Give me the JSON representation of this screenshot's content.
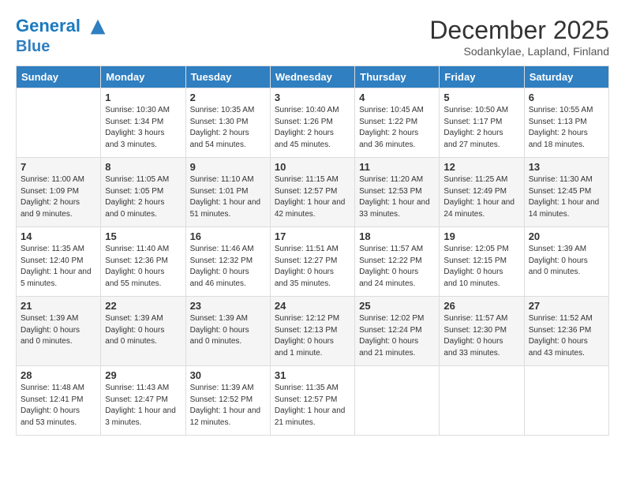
{
  "header": {
    "logo_line1": "General",
    "logo_line2": "Blue",
    "month": "December 2025",
    "location": "Sodankylae, Lapland, Finland"
  },
  "weekdays": [
    "Sunday",
    "Monday",
    "Tuesday",
    "Wednesday",
    "Thursday",
    "Friday",
    "Saturday"
  ],
  "weeks": [
    [
      {
        "day": "",
        "info": ""
      },
      {
        "day": "1",
        "info": "Sunrise: 10:30 AM\nSunset: 1:34 PM\nDaylight: 3 hours\nand 3 minutes."
      },
      {
        "day": "2",
        "info": "Sunrise: 10:35 AM\nSunset: 1:30 PM\nDaylight: 2 hours\nand 54 minutes."
      },
      {
        "day": "3",
        "info": "Sunrise: 10:40 AM\nSunset: 1:26 PM\nDaylight: 2 hours\nand 45 minutes."
      },
      {
        "day": "4",
        "info": "Sunrise: 10:45 AM\nSunset: 1:22 PM\nDaylight: 2 hours\nand 36 minutes."
      },
      {
        "day": "5",
        "info": "Sunrise: 10:50 AM\nSunset: 1:17 PM\nDaylight: 2 hours\nand 27 minutes."
      },
      {
        "day": "6",
        "info": "Sunrise: 10:55 AM\nSunset: 1:13 PM\nDaylight: 2 hours\nand 18 minutes."
      }
    ],
    [
      {
        "day": "7",
        "info": "Sunrise: 11:00 AM\nSunset: 1:09 PM\nDaylight: 2 hours\nand 9 minutes."
      },
      {
        "day": "8",
        "info": "Sunrise: 11:05 AM\nSunset: 1:05 PM\nDaylight: 2 hours\nand 0 minutes."
      },
      {
        "day": "9",
        "info": "Sunrise: 11:10 AM\nSunset: 1:01 PM\nDaylight: 1 hour and\n51 minutes."
      },
      {
        "day": "10",
        "info": "Sunrise: 11:15 AM\nSunset: 12:57 PM\nDaylight: 1 hour and\n42 minutes."
      },
      {
        "day": "11",
        "info": "Sunrise: 11:20 AM\nSunset: 12:53 PM\nDaylight: 1 hour and\n33 minutes."
      },
      {
        "day": "12",
        "info": "Sunrise: 11:25 AM\nSunset: 12:49 PM\nDaylight: 1 hour and\n24 minutes."
      },
      {
        "day": "13",
        "info": "Sunrise: 11:30 AM\nSunset: 12:45 PM\nDaylight: 1 hour and\n14 minutes."
      }
    ],
    [
      {
        "day": "14",
        "info": "Sunrise: 11:35 AM\nSunset: 12:40 PM\nDaylight: 1 hour and\n5 minutes."
      },
      {
        "day": "15",
        "info": "Sunrise: 11:40 AM\nSunset: 12:36 PM\nDaylight: 0 hours\nand 55 minutes."
      },
      {
        "day": "16",
        "info": "Sunrise: 11:46 AM\nSunset: 12:32 PM\nDaylight: 0 hours\nand 46 minutes."
      },
      {
        "day": "17",
        "info": "Sunrise: 11:51 AM\nSunset: 12:27 PM\nDaylight: 0 hours\nand 35 minutes."
      },
      {
        "day": "18",
        "info": "Sunrise: 11:57 AM\nSunset: 12:22 PM\nDaylight: 0 hours\nand 24 minutes."
      },
      {
        "day": "19",
        "info": "Sunrise: 12:05 PM\nSunset: 12:15 PM\nDaylight: 0 hours\nand 10 minutes."
      },
      {
        "day": "20",
        "info": "Sunset: 1:39 AM\nDaylight: 0 hours\nand 0 minutes."
      }
    ],
    [
      {
        "day": "21",
        "info": "Sunset: 1:39 AM\nDaylight: 0 hours\nand 0 minutes."
      },
      {
        "day": "22",
        "info": "Sunset: 1:39 AM\nDaylight: 0 hours\nand 0 minutes."
      },
      {
        "day": "23",
        "info": "Sunset: 1:39 AM\nDaylight: 0 hours\nand 0 minutes."
      },
      {
        "day": "24",
        "info": "Sunrise: 12:12 PM\nSunset: 12:13 PM\nDaylight: 0 hours\nand 1 minute."
      },
      {
        "day": "25",
        "info": "Sunrise: 12:02 PM\nSunset: 12:24 PM\nDaylight: 0 hours\nand 21 minutes."
      },
      {
        "day": "26",
        "info": "Sunrise: 11:57 AM\nSunset: 12:30 PM\nDaylight: 0 hours\nand 33 minutes."
      },
      {
        "day": "27",
        "info": "Sunrise: 11:52 AM\nSunset: 12:36 PM\nDaylight: 0 hours\nand 43 minutes."
      }
    ],
    [
      {
        "day": "28",
        "info": "Sunrise: 11:48 AM\nSunset: 12:41 PM\nDaylight: 0 hours\nand 53 minutes."
      },
      {
        "day": "29",
        "info": "Sunrise: 11:43 AM\nSunset: 12:47 PM\nDaylight: 1 hour and\n3 minutes."
      },
      {
        "day": "30",
        "info": "Sunrise: 11:39 AM\nSunset: 12:52 PM\nDaylight: 1 hour and\n12 minutes."
      },
      {
        "day": "31",
        "info": "Sunrise: 11:35 AM\nSunset: 12:57 PM\nDaylight: 1 hour and\n21 minutes."
      },
      {
        "day": "",
        "info": ""
      },
      {
        "day": "",
        "info": ""
      },
      {
        "day": "",
        "info": ""
      }
    ]
  ]
}
